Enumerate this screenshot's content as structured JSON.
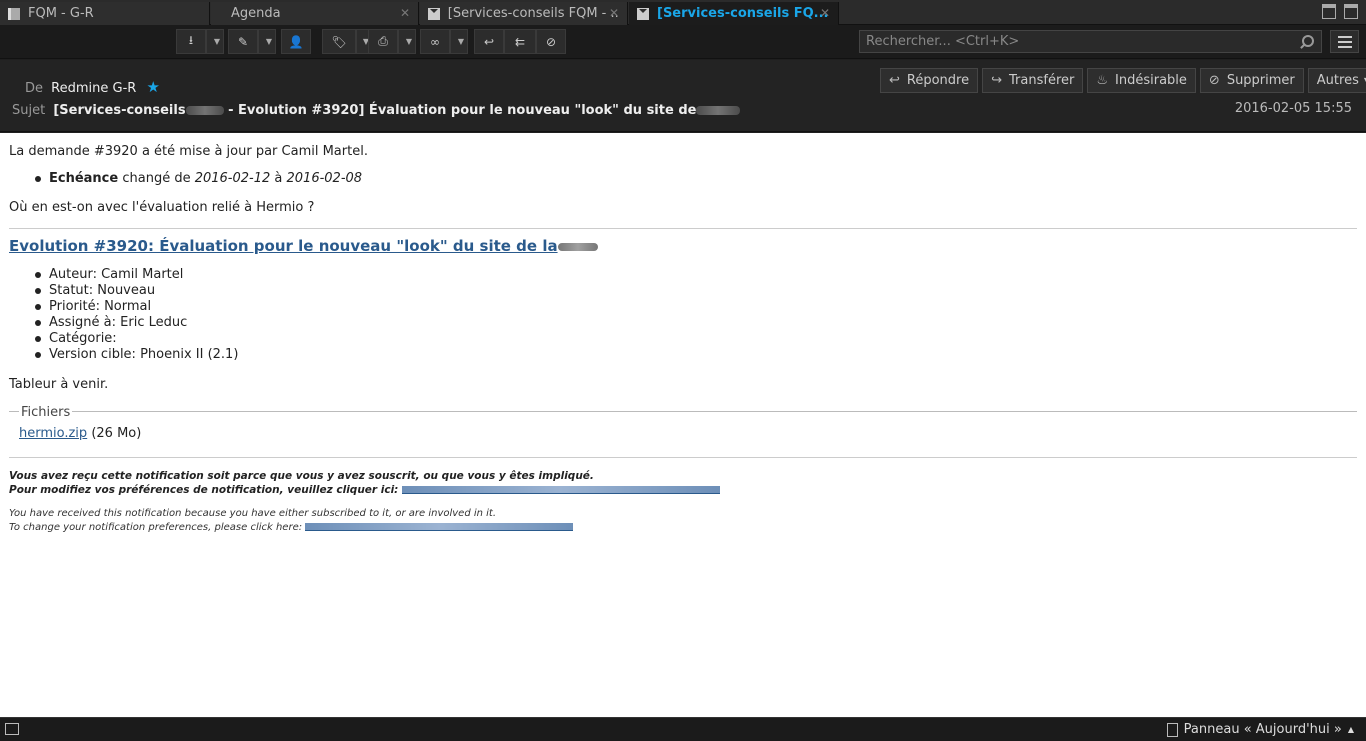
{
  "tabs": [
    {
      "label": "FQM - G-R",
      "icon": "document-icon",
      "active": false
    },
    {
      "label": "Agenda",
      "icon": "calendar-icon",
      "active": false
    },
    {
      "label": "[Services-conseils FQM - ...",
      "icon": "envelope-icon",
      "active": false
    },
    {
      "label": "[Services-conseils FQ...",
      "icon": "envelope-icon",
      "active": true
    }
  ],
  "toolbar": {
    "buttons": [
      "get-mail",
      "write",
      "address-book",
      "tag",
      "print",
      "view",
      "reply",
      "reply-all",
      "junk"
    ],
    "search_placeholder": "Rechercher... <Ctrl+K>"
  },
  "header": {
    "from_label": "De",
    "sender": "Redmine G-R",
    "subject_label": "Sujet",
    "subject_part1": "[Services-conseils",
    "subject_part2": "- Evolution #3920] Évaluation pour le nouveau \"look\" du site de",
    "date": "2016-02-05 15:55",
    "actions": {
      "reply": "Répondre",
      "forward": "Transférer",
      "junk": "Indésirable",
      "delete": "Supprimer",
      "other": "Autres"
    }
  },
  "body": {
    "intro": "La demande #3920 a été mise à jour par Camil Martel.",
    "change_field": "Echéance",
    "change_text1": " changé de ",
    "change_from": "2016-02-12",
    "change_text2": " à ",
    "change_to": "2016-02-08",
    "question": "Où en est-on avec l'évaluation relié à Hermio ?",
    "issue_title": "Evolution #3920: Évaluation pour le nouveau \"look\" du site de la",
    "details": [
      "Auteur: Camil Martel",
      "Statut: Nouveau",
      "Priorité: Normal",
      "Assigné à: Eric Leduc",
      "Catégorie:",
      "Version cible: Phoenix II (2.1)"
    ],
    "description": "Tableur à venir.",
    "files_legend": "Fichiers",
    "file_name": "hermio.zip",
    "file_size": "(26 Mo)",
    "footer_fr_1": "Vous avez reçu cette notification soit parce que vous y avez souscrit, ou que vous y êtes impliqué.",
    "footer_fr_2": "Pour modifiez vos préférences de notification, veuillez cliquer ici:",
    "footer_en_1": "You have received this notification because you have either subscribed to it, or are involved in it.",
    "footer_en_2": "To change your notification preferences, please click here:"
  },
  "statusbar": {
    "panel_label": "Panneau « Aujourd'hui »"
  }
}
